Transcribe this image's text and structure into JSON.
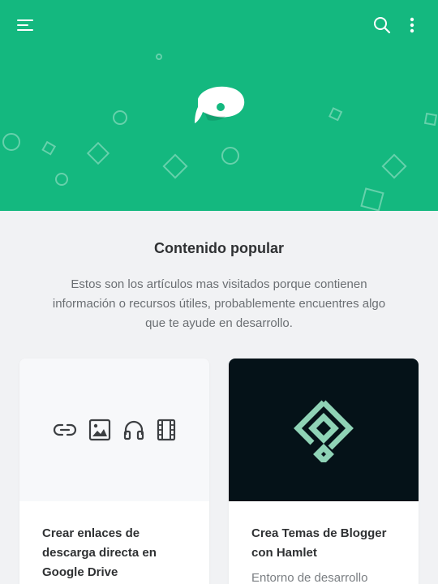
{
  "header": {
    "icons": [
      "menu-icon",
      "search-icon",
      "more-vertical-icon"
    ],
    "logo": "whale-logo",
    "background_color": "#14b87f"
  },
  "section": {
    "title": "Contenido popular",
    "description": "Estos son los artículos mas visitados porque contienen información o recursos útiles, probablemente encuentres algo que te ayude en desarrollo."
  },
  "cards": [
    {
      "title": "Crear enlaces de descarga directa en Google Drive",
      "media_icons": [
        "link-icon",
        "image-icon",
        "headphones-icon",
        "film-icon"
      ]
    },
    {
      "title": "Crea Temas de Blogger con Hamlet",
      "subtitle": "Entorno de desarrollo",
      "media_icon": "hamlet-logo-icon",
      "media_background": "#051218"
    }
  ]
}
